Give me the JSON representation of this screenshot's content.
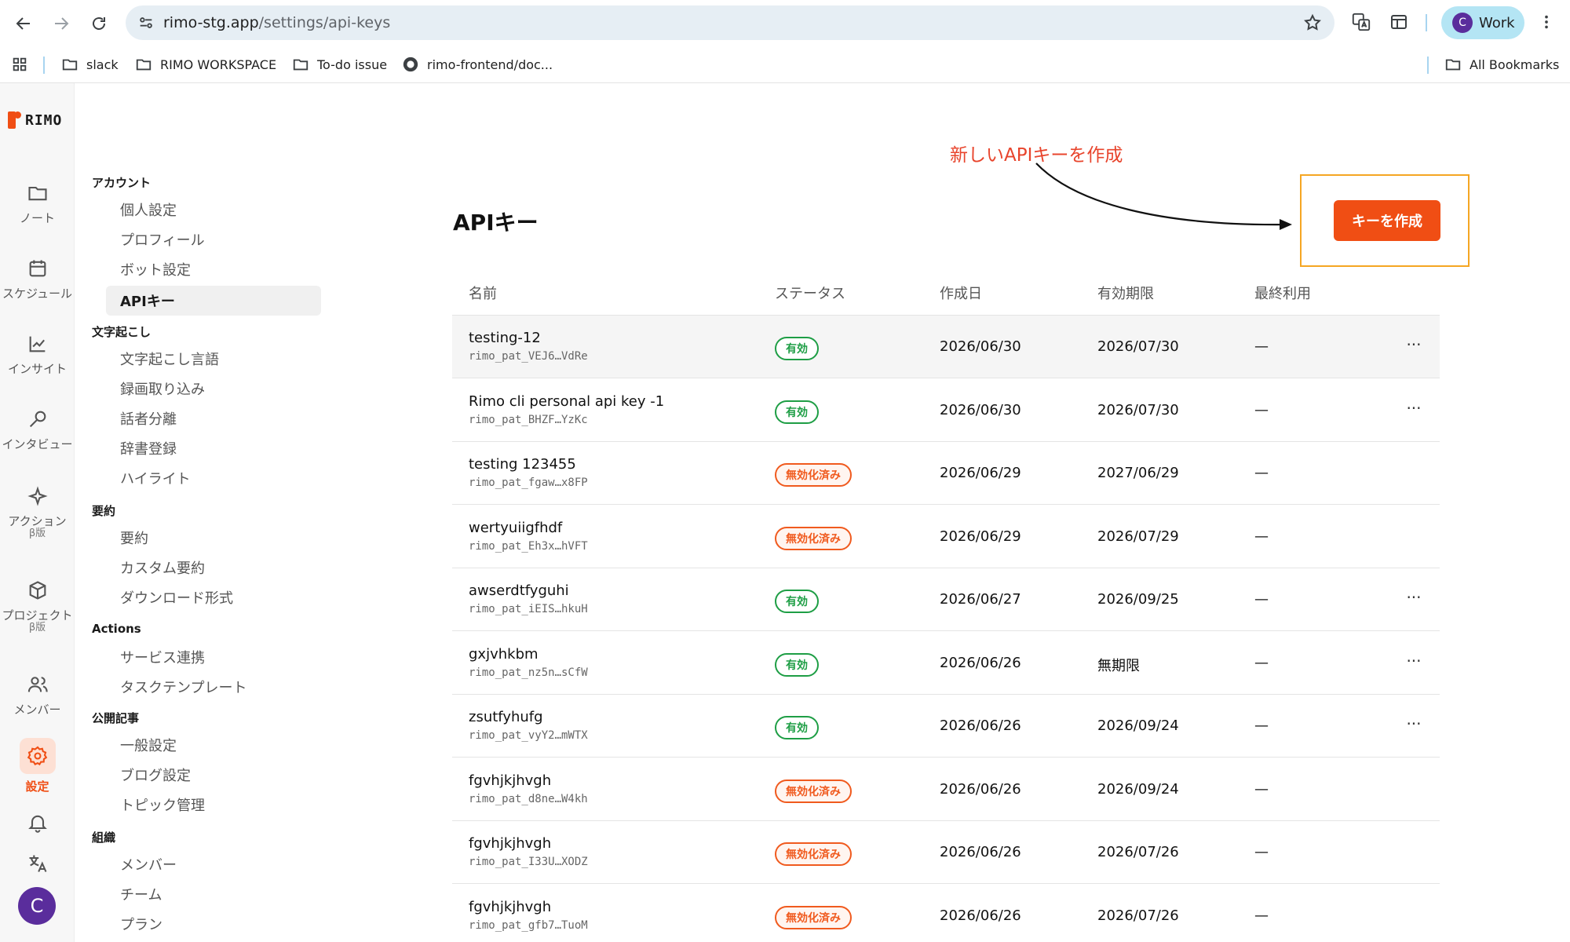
{
  "browser": {
    "url_host": "rimo-stg.app",
    "url_path": "/settings/api-keys",
    "profile_initial": "C",
    "profile_label": "Work",
    "bookmarks": [
      "slack",
      "RIMO WORKSPACE",
      "To-do issue",
      "rimo-frontend/doc..."
    ],
    "all_bookmarks": "All Bookmarks"
  },
  "app": {
    "logo_text": "RIMO",
    "brand_color": "#f04e14",
    "rail": [
      {
        "label": "ノート",
        "icon": "folder-icon"
      },
      {
        "label": "スケジュール",
        "icon": "calendar-icon"
      },
      {
        "label": "インサイト",
        "icon": "chart-icon"
      },
      {
        "label": "インタビュー",
        "icon": "microphone-icon"
      },
      {
        "label": "アクション",
        "beta": "β版",
        "icon": "sparkle-icon"
      },
      {
        "label": "プロジェクト",
        "beta": "β版",
        "icon": "box-icon"
      },
      {
        "label": "メンバー",
        "icon": "users-icon"
      },
      {
        "label": "設定",
        "icon": "gear-icon"
      }
    ],
    "avatar_initial": "C"
  },
  "settings_nav": {
    "groups": [
      {
        "title": "アカウント",
        "items": [
          "個人設定",
          "プロフィール",
          "ボット設定",
          "APIキー"
        ]
      },
      {
        "title": "文字起こし",
        "items": [
          "文字起こし言語",
          "録画取り込み",
          "話者分離",
          "辞書登録",
          "ハイライト"
        ]
      },
      {
        "title": "要約",
        "items": [
          "要約",
          "カスタム要約",
          "ダウンロード形式"
        ]
      },
      {
        "title": "Actions",
        "items": [
          "サービス連携",
          "タスクテンプレート"
        ]
      },
      {
        "title": "公開記事",
        "items": [
          "一般設定",
          "ブログ設定",
          "トピック管理"
        ]
      },
      {
        "title": "組織",
        "items": [
          "メンバー",
          "チーム",
          "プラン"
        ]
      }
    ]
  },
  "main": {
    "title": "APIキー",
    "annotation": "新しいAPIキーを作成",
    "create_button": "キーを作成",
    "columns": [
      "名前",
      "ステータス",
      "作成日",
      "有効期限",
      "最終利用"
    ],
    "rows": [
      {
        "name": "testing-12",
        "key": "rimo_pat_VEJ6…VdRe",
        "status": "有効",
        "created": "2026/06/30",
        "expiry": "2026/07/30",
        "last": "—",
        "more": "···"
      },
      {
        "name": "Rimo cli personal api key -1",
        "key": "rimo_pat_BHZF…YzKc",
        "status": "有効",
        "created": "2026/06/30",
        "expiry": "2026/07/30",
        "last": "—",
        "more": "···"
      },
      {
        "name": "testing 123455",
        "key": "rimo_pat_fgaw…x8FP",
        "status": "無効化済み",
        "created": "2026/06/29",
        "expiry": "2027/06/29",
        "last": "—",
        "more": ""
      },
      {
        "name": "wertyuiigfhdf",
        "key": "rimo_pat_Eh3x…hVFT",
        "status": "無効化済み",
        "created": "2026/06/29",
        "expiry": "2026/07/29",
        "last": "—",
        "more": ""
      },
      {
        "name": "awserdtfyguhi",
        "key": "rimo_pat_iEIS…hkuH",
        "status": "有効",
        "created": "2026/06/27",
        "expiry": "2026/09/25",
        "last": "—",
        "more": "···"
      },
      {
        "name": "gxjvhkbm",
        "key": "rimo_pat_nz5n…sCfW",
        "status": "有効",
        "created": "2026/06/26",
        "expiry": "無期限",
        "last": "—",
        "more": "···"
      },
      {
        "name": "zsutfyhufg",
        "key": "rimo_pat_vyY2…mWTX",
        "status": "有効",
        "created": "2026/06/26",
        "expiry": "2026/09/24",
        "last": "—",
        "more": "···"
      },
      {
        "name": "fgvhjkjhvgh",
        "key": "rimo_pat_d8ne…W4kh",
        "status": "無効化済み",
        "created": "2026/06/26",
        "expiry": "2026/09/24",
        "last": "—",
        "more": ""
      },
      {
        "name": "fgvhjkjhvgh",
        "key": "rimo_pat_I33U…XODZ",
        "status": "無効化済み",
        "created": "2026/06/26",
        "expiry": "2026/07/26",
        "last": "—",
        "more": ""
      },
      {
        "name": "fgvhjkjhvgh",
        "key": "rimo_pat_gfb7…TuoM",
        "status": "無効化済み",
        "created": "2026/06/26",
        "expiry": "2026/07/26",
        "last": "—",
        "more": ""
      }
    ]
  }
}
